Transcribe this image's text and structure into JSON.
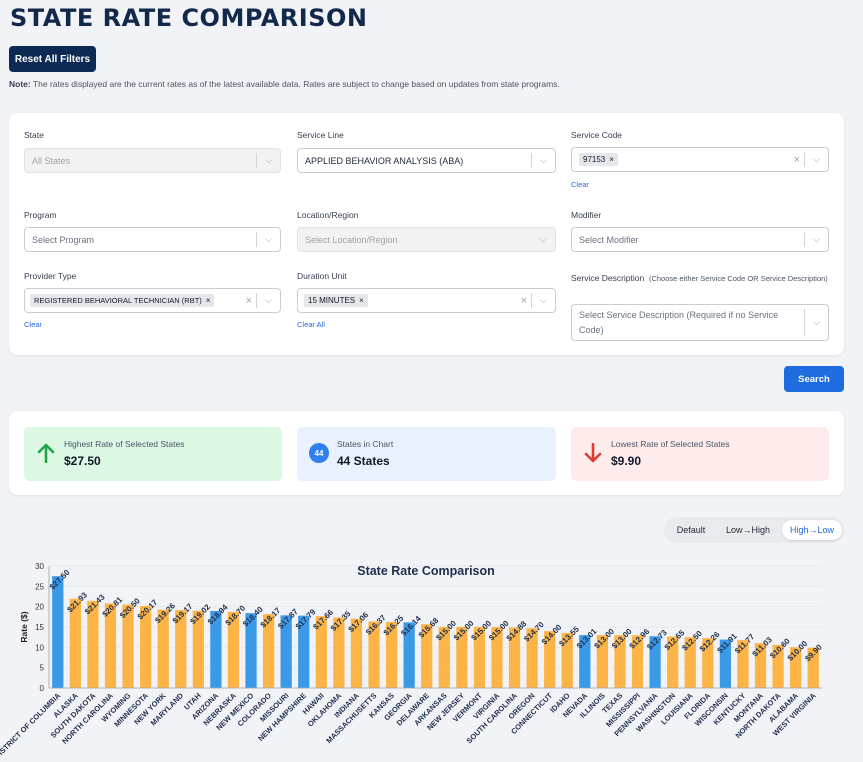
{
  "page": {
    "title": "STATE RATE COMPARISON",
    "reset_label": "Reset All Filters",
    "note_label": "Note:",
    "note_text": " The rates displayed are the current rates as of the latest available data. Rates are subject to change based on updates from state programs."
  },
  "filters": {
    "state": {
      "label": "State",
      "placeholder": "All States"
    },
    "service_line": {
      "label": "Service Line",
      "value": "APPLIED BEHAVIOR ANALYSIS (ABA)"
    },
    "service_code": {
      "label": "Service Code",
      "tag": "97153",
      "clear": "Clear"
    },
    "program": {
      "label": "Program",
      "placeholder": "Select Program"
    },
    "location": {
      "label": "Location/Region",
      "placeholder": "Select Location/Region"
    },
    "modifier": {
      "label": "Modifier",
      "placeholder": "Select Modifier"
    },
    "provider_type": {
      "label": "Provider Type",
      "tag": "REGISTERED BEHAVIORAL TECHNICIAN (RBT)",
      "clear": "Clear"
    },
    "duration_unit": {
      "label": "Duration Unit",
      "tag": "15 MINUTES",
      "clear": "Clear All"
    },
    "service_description": {
      "label": "Service Description",
      "hint": "(Choose either Service Code OR Service Description)",
      "placeholder": "Select Service Description (Required if no Service Code)"
    },
    "tag_remove": "×",
    "clear_x": "×",
    "chevron": "⌵"
  },
  "search_label": "Search",
  "stats": {
    "highest": {
      "label": "Highest Rate of Selected States",
      "value": "$27.50",
      "icon": "arrow-up-icon"
    },
    "count": {
      "label": "States in Chart",
      "value": "44 States",
      "badge": "44"
    },
    "lowest": {
      "label": "Lowest Rate of Selected States",
      "value": "$9.90",
      "icon": "arrow-down-icon"
    }
  },
  "colors": {
    "blue": "#3a9ae8",
    "orange": "#fdb446",
    "highest_bg": "#dcf8e5",
    "count_bg": "#e8f1fd",
    "lowest_bg": "#fdeceb",
    "green": "#22a447",
    "red": "#e23b30"
  },
  "sort": {
    "default": "Default",
    "low_high": "Low→High",
    "high_low": "High→Low",
    "active": "high_low"
  },
  "chart_data": {
    "type": "bar",
    "title": "State Rate Comparison",
    "ylabel": "Rate ($)",
    "ylim": [
      0,
      30
    ],
    "yticks": [
      0,
      5,
      10,
      15,
      20,
      25,
      30
    ],
    "grid": true,
    "categories": [
      "DISTRICT OF COLUMBIA",
      "ALASKA",
      "SOUTH DAKOTA",
      "NORTH CAROLINA",
      "WYOMING",
      "MINNESOTA",
      "NEW YORK",
      "MARYLAND",
      "UTAH",
      "ARIZONA",
      "NEBRASKA",
      "NEW MEXICO",
      "COLORADO",
      "MISSOURI",
      "NEW HAMPSHIRE",
      "HAWAII",
      "OKLAHOMA",
      "INDIANA",
      "MASSACHUSETTS",
      "KANSAS",
      "GEORGIA",
      "DELAWARE",
      "ARKANSAS",
      "NEW JERSEY",
      "VERMONT",
      "VIRGINIA",
      "SOUTH CAROLINA",
      "OREGON",
      "CONNECTICUT",
      "IDAHO",
      "NEVADA",
      "ILLINOIS",
      "TEXAS",
      "MISSISSIPPI",
      "PENNSYLVANIA",
      "WASHINGTON",
      "LOUISIANA",
      "FLORIDA",
      "WISCONSIN",
      "KENTUCKY",
      "MONTANA",
      "NORTH DAKOTA",
      "ALABAMA",
      "WEST VIRGINIA"
    ],
    "values": [
      27.5,
      21.93,
      21.43,
      20.81,
      20.5,
      20.17,
      19.26,
      19.17,
      19.02,
      18.94,
      18.7,
      18.4,
      18.17,
      17.87,
      17.79,
      17.66,
      17.35,
      17.06,
      16.37,
      16.25,
      16.14,
      15.68,
      15.0,
      15.0,
      15.0,
      15.0,
      14.88,
      14.7,
      14.0,
      13.55,
      13.01,
      13.0,
      13.0,
      12.96,
      12.73,
      12.65,
      12.5,
      12.26,
      11.91,
      11.77,
      11.03,
      10.6,
      10.0,
      9.9
    ],
    "labels": [
      "$27.50",
      "$21.93",
      "$21.43",
      "$20.81",
      "$20.50",
      "$20.17",
      "$19.26",
      "$19.17",
      "$19.02",
      "$18.94",
      "$18.70",
      "$18.40",
      "$18.17",
      "$17.87",
      "$17.79",
      "$17.66",
      "$17.35",
      "$17.06",
      "$16.37",
      "$16.25",
      "$16.14",
      "$15.68",
      "$15.00",
      "$15.00",
      "$15.00",
      "$15.00",
      "$14.88",
      "$14.70",
      "$14.00",
      "$13.55",
      "$13.01",
      "$13.00",
      "$13.00",
      "$12.96",
      "$12.73",
      "$12.65",
      "$12.50",
      "$12.26",
      "$11.91",
      "$11.77",
      "$11.03",
      "$10.60",
      "$10.00",
      "$9.90"
    ],
    "highlight": [
      true,
      false,
      false,
      false,
      false,
      false,
      false,
      false,
      false,
      true,
      false,
      true,
      false,
      true,
      true,
      false,
      false,
      false,
      false,
      false,
      true,
      false,
      false,
      false,
      false,
      false,
      false,
      false,
      false,
      false,
      true,
      false,
      false,
      false,
      true,
      false,
      false,
      false,
      true,
      false,
      false,
      false,
      false,
      false
    ]
  }
}
